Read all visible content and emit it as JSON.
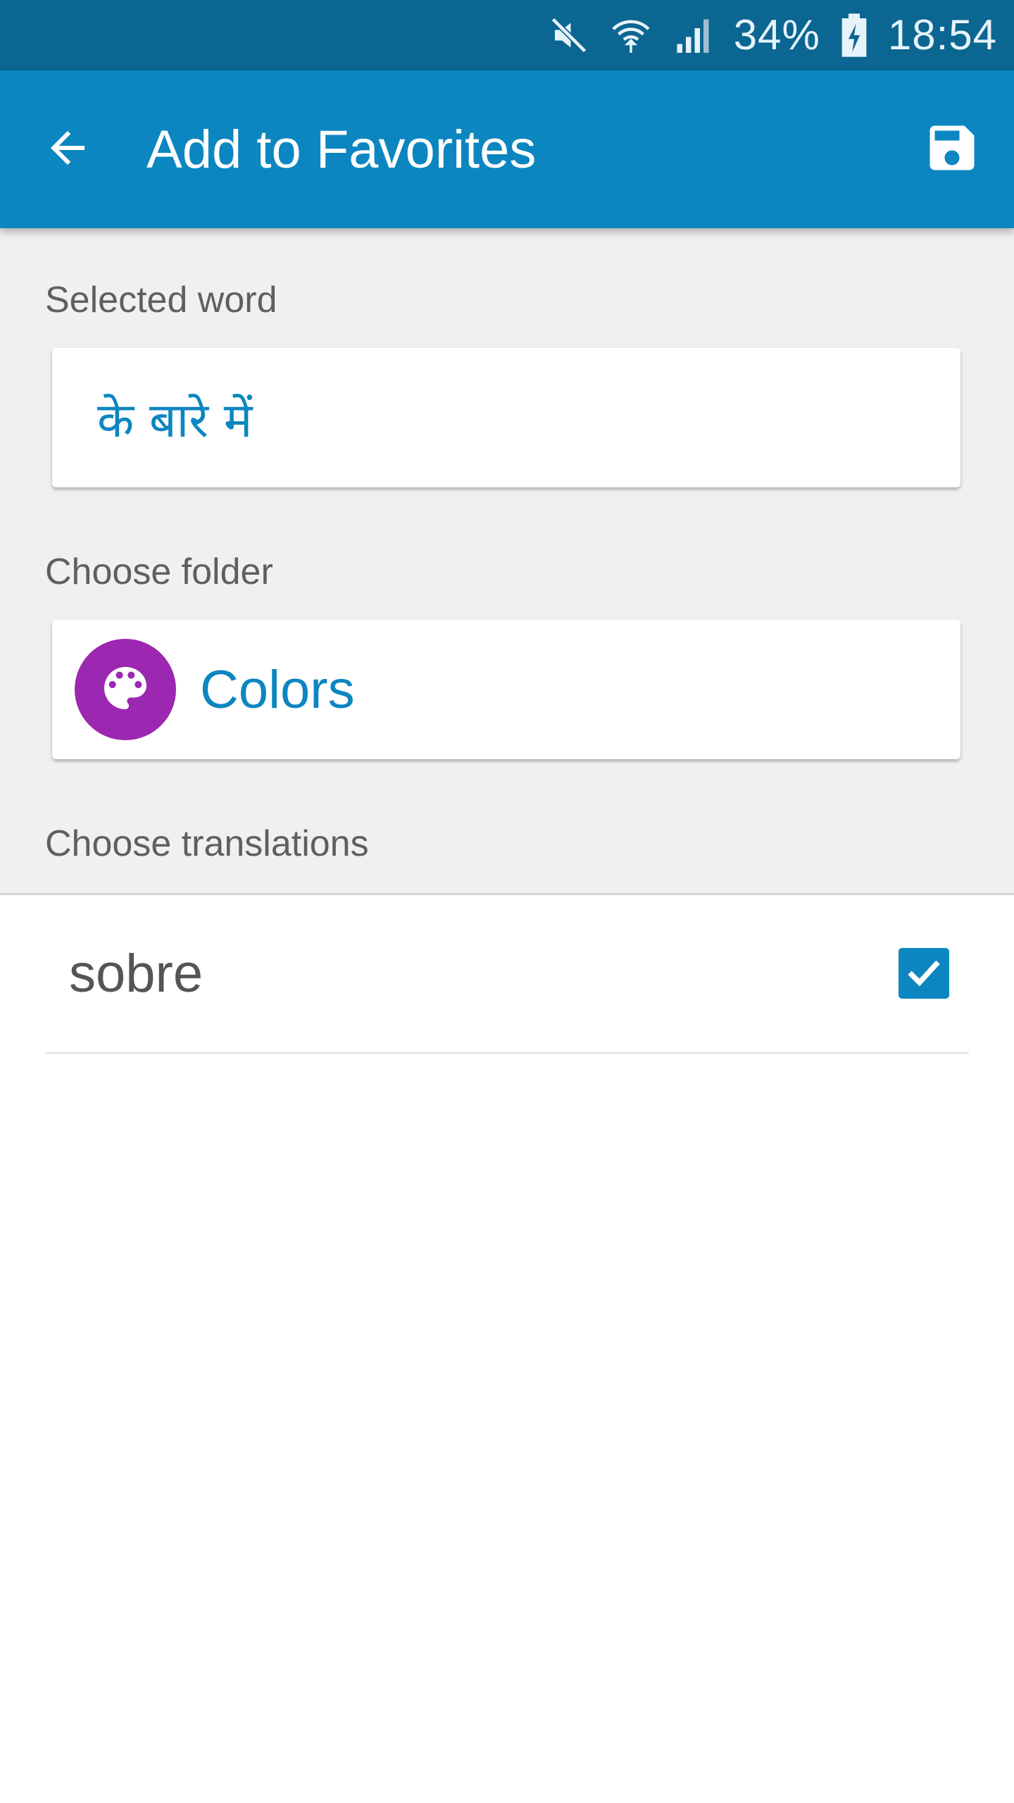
{
  "status_bar": {
    "battery": "34%",
    "time": "18:54",
    "icons": [
      "mute-icon",
      "wifi-icon",
      "signal-icon",
      "battery-charging-icon"
    ]
  },
  "app_bar": {
    "title": "Add to Favorites",
    "back_icon": "arrow-back-icon",
    "save_icon": "save-icon"
  },
  "form": {
    "selected_word_label": "Selected word",
    "selected_word": "के बारे में",
    "folder_label": "Choose folder",
    "folder": {
      "name": "Colors",
      "icon": "palette-icon",
      "icon_color": "#9c27b0"
    },
    "translations_label": "Choose translations"
  },
  "translations": [
    {
      "text": "sobre",
      "checked": true
    }
  ],
  "colors": {
    "accent": "#0c86c0",
    "status_bar": "#0b6691",
    "checkbox": "#0c86c0"
  }
}
